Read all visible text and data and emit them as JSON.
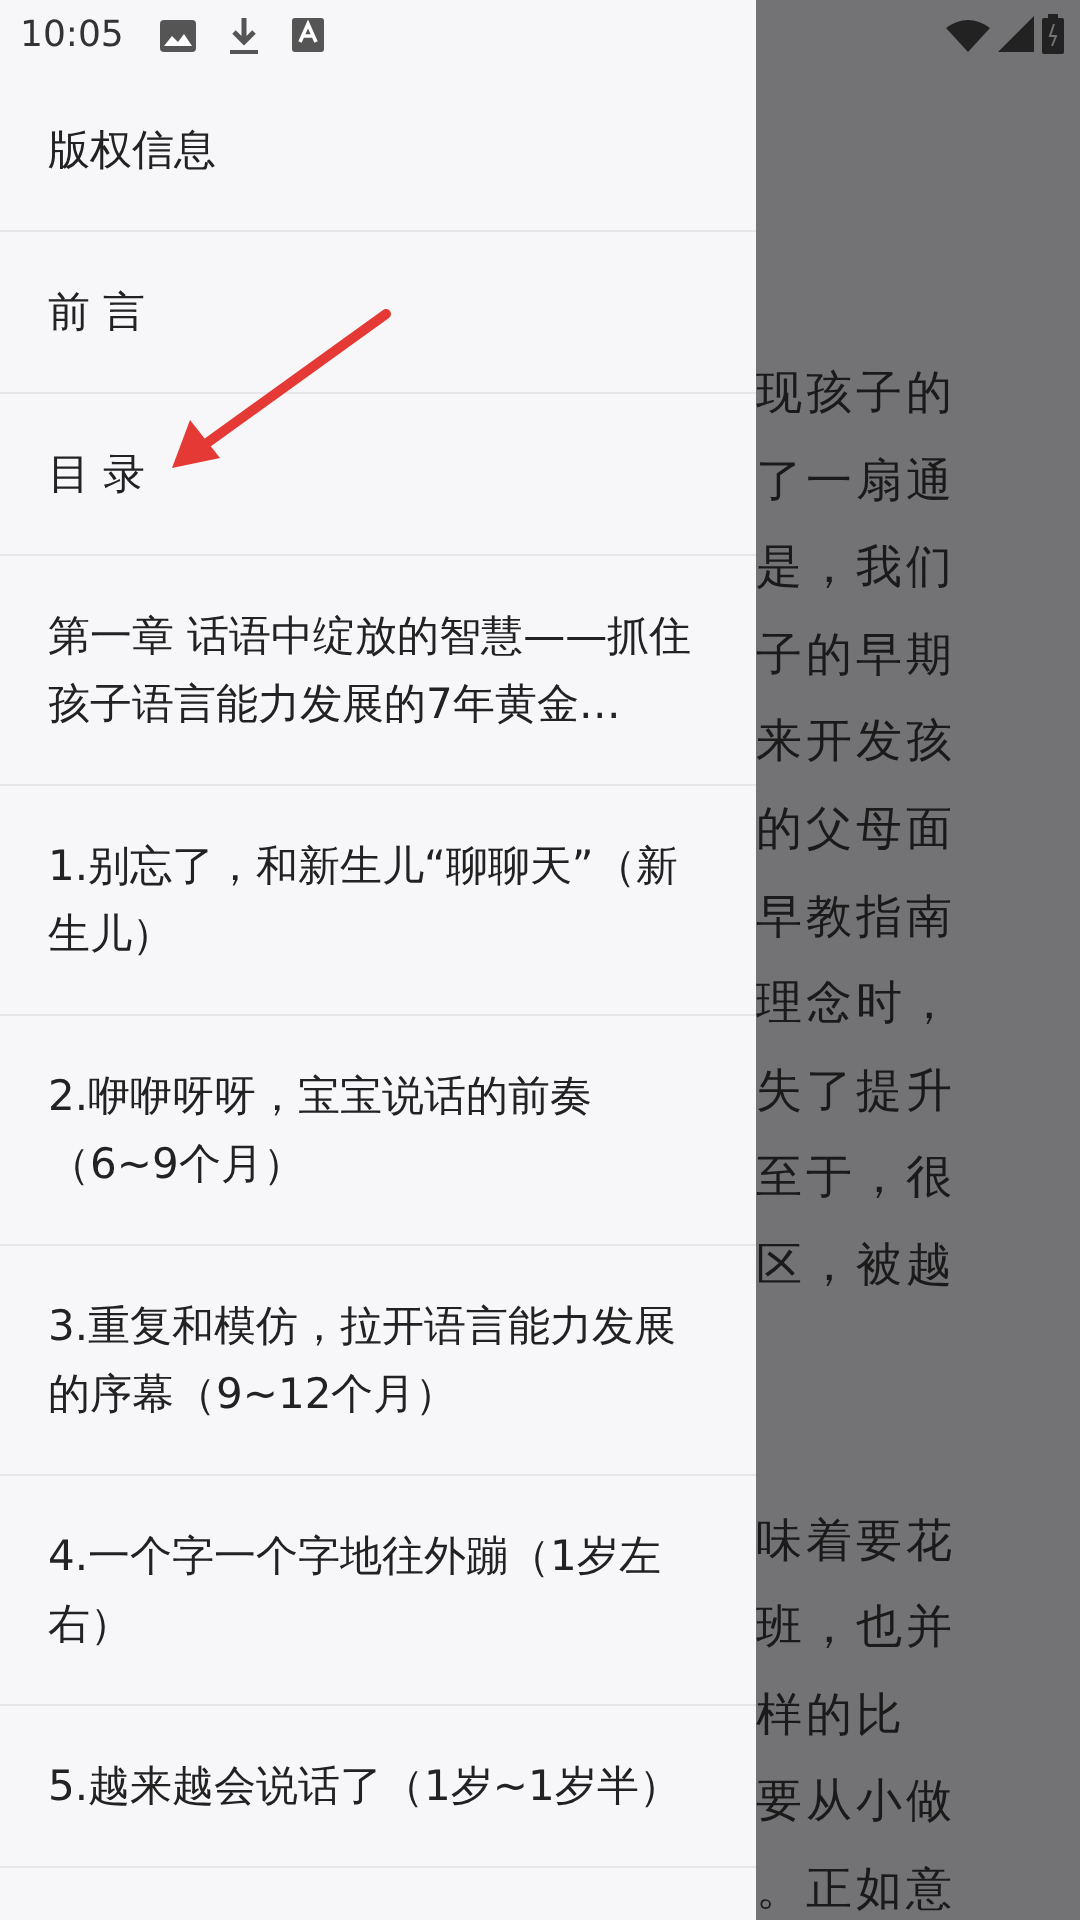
{
  "status_bar": {
    "time": "10:05"
  },
  "drawer": {
    "items": [
      {
        "label": "版权信息"
      },
      {
        "label": "前 言"
      },
      {
        "label": "目 录"
      },
      {
        "label": "第一章 话语中绽放的智慧——抓住孩子语言能力发展的7年黄金…"
      },
      {
        "label": "1.别忘了，和新生儿“聊聊天”（新生儿）"
      },
      {
        "label": "2.咿咿呀呀，宝宝说话的前奏（6~9个月）"
      },
      {
        "label": "3.重复和模仿，拉开语言能力发展的序幕（9~12个月）"
      },
      {
        "label": "4.一个字一个字地往外蹦（1岁左右）"
      },
      {
        "label": "5.越来越会说话了（1岁~1岁半）"
      }
    ]
  },
  "page_text": {
    "paragraphs": [
      [
        "现孩子的",
        "了一扇通",
        "是，我们",
        "子的早期",
        "来开发孩",
        "的父母面",
        "早教指南",
        "理念时，",
        "失了提升",
        "至于，很",
        "区，被越"
      ],
      [
        "味着要花",
        "班，也并",
        "样的比",
        "要从小做",
        "。正如意"
      ]
    ]
  }
}
